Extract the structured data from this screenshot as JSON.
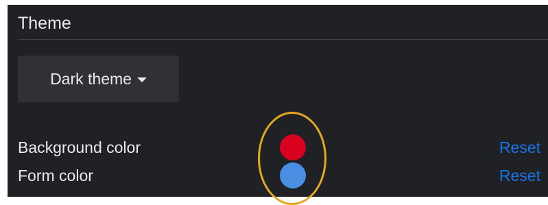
{
  "theme_section": {
    "title": "Theme",
    "dropdown": {
      "selected": "Dark theme"
    },
    "rows": [
      {
        "label": "Background color",
        "swatch_color": "#d7001e",
        "reset_label": "Reset"
      },
      {
        "label": "Form color",
        "swatch_color": "#4a90e2",
        "reset_label": "Reset"
      }
    ]
  },
  "colors": {
    "panel_background": "#202124",
    "text": "#e8eaed",
    "link": "#1a73e8",
    "highlight_ring": "#e5a823"
  }
}
